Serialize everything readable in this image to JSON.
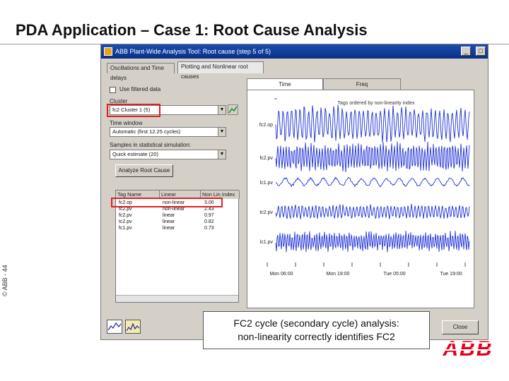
{
  "slide": {
    "title": "PDA Application – Case 1: Root Cause Analysis",
    "side_label": "© ABB - 44",
    "callout_line1": "FC2 cycle (secondary cycle) analysis:",
    "callout_line2": "non-linearity correctly identifies FC2",
    "logo_text": "ABB"
  },
  "window": {
    "title": "ABB Plant-Wide Analysis Tool: Root cause (step 5 of 5)",
    "tabs": [
      {
        "label": "Oscillations and Time delays"
      },
      {
        "label": "Plotting and Nonlinear root causes"
      }
    ],
    "minimize": "_",
    "maximize": "□",
    "close": "×"
  },
  "left": {
    "use_filtered_label": "Use filtered data",
    "cluster_label": "Cluster",
    "cluster_value": "fc2 Cluster 1  (5)",
    "time_window_label": "Time window",
    "time_window_value": "Automatic (first 12.25 cycles)",
    "surrogate_label": "Samples in statistical simulation:",
    "surrogate_value": "Quick estimate (20)",
    "analyze_button": "Analyze Root Cause",
    "columns": [
      "Tag Name",
      "Linear",
      "Non Lin Index"
    ],
    "rows": [
      [
        "fc2.op",
        "non-linear",
        "3.00"
      ],
      [
        "tc2.pv",
        "non-linear",
        "2.43"
      ],
      [
        "fc2.pv",
        "linear",
        "0.97"
      ],
      [
        "tc2.pv",
        "linear",
        "0.82"
      ],
      [
        "fc1.pv",
        "linear",
        "0.73"
      ]
    ]
  },
  "plot": {
    "tabs": [
      {
        "label": "Time"
      },
      {
        "label": "Freq"
      }
    ],
    "title": "Tags ordered by non-linearity index",
    "series_labels": [
      "fc2.op",
      "fc2.pv",
      "lc1.pv",
      "tc2.pv",
      "lc1.pv"
    ],
    "x_ticks": [
      "Mon 06:00",
      "Mon 19:00",
      "Tue 05:00",
      "Tue 19:00"
    ]
  },
  "bottom": {
    "close_button": "Close"
  }
}
